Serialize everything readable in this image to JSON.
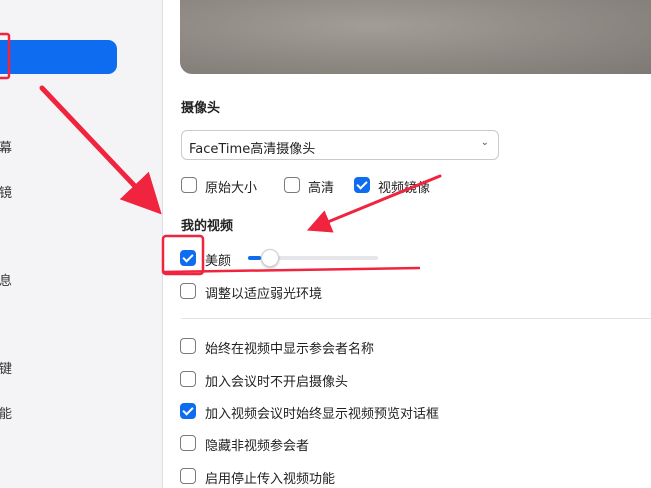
{
  "sidebar": {
    "items": [
      {
        "label": "屏幕"
      },
      {
        "label": "背景和滤镜"
      },
      {
        "label": "消息"
      },
      {
        "label": "快捷键"
      },
      {
        "label": "功能"
      }
    ]
  },
  "camera": {
    "section_title": "摄像头",
    "selected_device": "FaceTime高清摄像头",
    "options": [
      {
        "label": "原始大小",
        "checked": false
      },
      {
        "label": "高清",
        "checked": false
      },
      {
        "label": "视频镜像",
        "checked": true
      }
    ]
  },
  "my_video": {
    "section_title": "我的视频",
    "beautify": {
      "label": "美颜",
      "checked": true,
      "slider_level_percent": 10
    },
    "low_light": {
      "label": "调整以适应弱光环境",
      "checked": false
    }
  },
  "general_options": [
    {
      "label": "始终在视频中显示参会者名称",
      "checked": false
    },
    {
      "label": "加入会议时不开启摄像头",
      "checked": false
    },
    {
      "label": "加入视频会议时始终显示视频预览对话框",
      "checked": true
    },
    {
      "label": "隐藏非视频参会者",
      "checked": false
    },
    {
      "label": "启用停止传入视频功能",
      "checked": false
    }
  ],
  "colors": {
    "accent": "#0e6cf0",
    "annotation": "#f0243f"
  }
}
